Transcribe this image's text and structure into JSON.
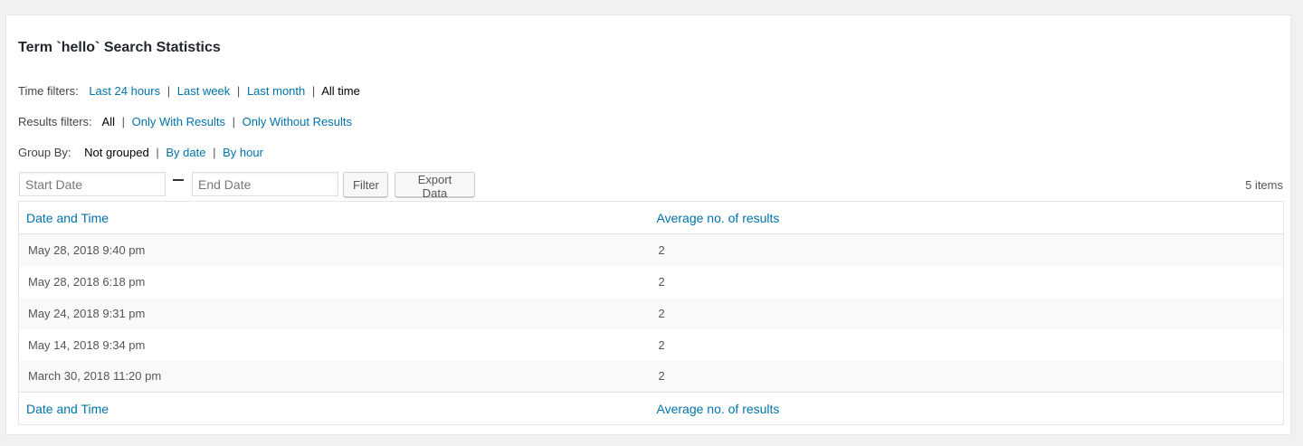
{
  "page": {
    "title": "Term `hello` Search Statistics"
  },
  "time_filters": {
    "label": "Time filters:",
    "options": [
      "Last 24 hours",
      "Last week",
      "Last month",
      "All time"
    ],
    "current": "All time"
  },
  "results_filters": {
    "label": "Results filters:",
    "options": [
      "All",
      "Only With Results",
      "Only Without Results"
    ],
    "current": "All"
  },
  "group_by": {
    "label": "Group By:",
    "options": [
      "Not grouped",
      "By date",
      "By hour"
    ],
    "current": "Not grouped"
  },
  "date_range": {
    "start_placeholder": "Start Date",
    "end_placeholder": "End Date"
  },
  "buttons": {
    "filter": "Filter",
    "export": "Export Data"
  },
  "items_count": "5 items",
  "table": {
    "columns": [
      "Date and Time",
      "Average no. of results"
    ],
    "rows": [
      [
        "May 28, 2018 9:40 pm",
        "2"
      ],
      [
        "May 28, 2018 6:18 pm",
        "2"
      ],
      [
        "May 24, 2018 9:31 pm",
        "2"
      ],
      [
        "May 14, 2018 9:34 pm",
        "2"
      ],
      [
        "March 30, 2018 11:20 pm",
        "2"
      ]
    ]
  },
  "colors": {
    "link": "#0073aa",
    "current": "#000000",
    "stripe": "#f9f9f9"
  }
}
